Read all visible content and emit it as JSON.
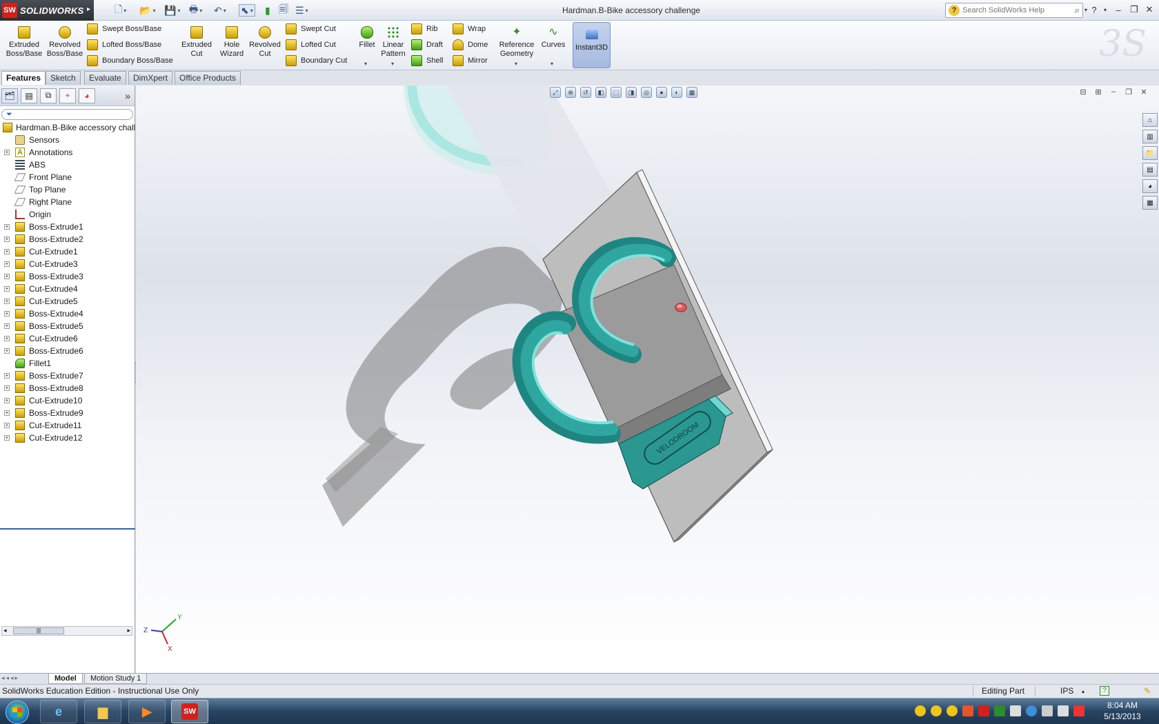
{
  "app": {
    "logo_badge": "SW",
    "logo_text": "SOLIDWORKS",
    "window_title": "Hardman.B-Bike accessory challenge"
  },
  "search": {
    "placeholder": "Search SolidWorks Help"
  },
  "toolbar": {
    "extruded_boss": [
      "Extruded",
      "Boss/Base"
    ],
    "revolved_boss": [
      "Revolved",
      "Boss/Base"
    ],
    "swept_boss": "Swept Boss/Base",
    "lofted_boss": "Lofted Boss/Base",
    "boundary_boss": "Boundary Boss/Base",
    "extruded_cut": [
      "Extruded",
      "Cut"
    ],
    "hole_wizard": [
      "Hole",
      "Wizard"
    ],
    "revolved_cut": [
      "Revolved",
      "Cut"
    ],
    "swept_cut": "Swept Cut",
    "lofted_cut": "Lofted Cut",
    "boundary_cut": "Boundary Cut",
    "fillet": "Fillet",
    "linear_pattern": [
      "Linear",
      "Pattern"
    ],
    "rib": "Rib",
    "draft": "Draft",
    "shell": "Shell",
    "wrap": "Wrap",
    "dome": "Dome",
    "mirror": "Mirror",
    "reference_geometry": [
      "Reference",
      "Geometry"
    ],
    "curves": "Curves",
    "instant3d": "Instant3D"
  },
  "tabs": [
    "Features",
    "Sketch",
    "Evaluate",
    "DimXpert",
    "Office Products"
  ],
  "active_tab": "Features",
  "feature_tree": {
    "root": "Hardman.B-Bike accessory challe",
    "items": [
      {
        "label": "Sensors",
        "expandable": false,
        "icon": "sensor-icon"
      },
      {
        "label": "Annotations",
        "expandable": true,
        "icon": "annotation-icon"
      },
      {
        "label": "ABS",
        "expandable": false,
        "icon": "material-icon"
      },
      {
        "label": "Front Plane",
        "expandable": false,
        "icon": "plane-icon"
      },
      {
        "label": "Top Plane",
        "expandable": false,
        "icon": "plane-icon"
      },
      {
        "label": "Right Plane",
        "expandable": false,
        "icon": "plane-icon"
      },
      {
        "label": "Origin",
        "expandable": false,
        "icon": "origin-icon"
      },
      {
        "label": "Boss-Extrude1",
        "expandable": true,
        "icon": "feature-icon"
      },
      {
        "label": "Boss-Extrude2",
        "expandable": true,
        "icon": "feature-icon"
      },
      {
        "label": "Cut-Extrude1",
        "expandable": true,
        "icon": "feature-icon"
      },
      {
        "label": "Cut-Extrude3",
        "expandable": true,
        "icon": "feature-icon"
      },
      {
        "label": "Boss-Extrude3",
        "expandable": true,
        "icon": "feature-icon"
      },
      {
        "label": "Cut-Extrude4",
        "expandable": true,
        "icon": "feature-icon"
      },
      {
        "label": "Cut-Extrude5",
        "expandable": true,
        "icon": "feature-icon"
      },
      {
        "label": "Boss-Extrude4",
        "expandable": true,
        "icon": "feature-icon"
      },
      {
        "label": "Boss-Extrude5",
        "expandable": true,
        "icon": "feature-icon"
      },
      {
        "label": "Cut-Extrude6",
        "expandable": true,
        "icon": "feature-icon"
      },
      {
        "label": "Boss-Extrude6",
        "expandable": true,
        "icon": "feature-icon"
      },
      {
        "label": "Fillet1",
        "expandable": false,
        "icon": "fillet-icon"
      },
      {
        "label": "Boss-Extrude7",
        "expandable": true,
        "icon": "feature-icon"
      },
      {
        "label": "Boss-Extrude8",
        "expandable": true,
        "icon": "feature-icon"
      },
      {
        "label": "Cut-Extrude10",
        "expandable": true,
        "icon": "feature-icon"
      },
      {
        "label": "Boss-Extrude9",
        "expandable": true,
        "icon": "feature-icon"
      },
      {
        "label": "Cut-Extrude11",
        "expandable": true,
        "icon": "feature-icon"
      },
      {
        "label": "Cut-Extrude12",
        "expandable": true,
        "icon": "feature-icon"
      }
    ]
  },
  "model": {
    "engraved_text": "VELODROOM",
    "accent_color": "#2fa7a0",
    "plate_color": "#b9b9b9"
  },
  "triad": {
    "x": "X",
    "y": "Y",
    "z": "Z"
  },
  "bottom_tabs": [
    "Model",
    "Motion Study 1"
  ],
  "status": {
    "left": "SolidWorks Education Edition - Instructional Use Only",
    "mode": "Editing Part",
    "units": "IPS",
    "help": "?"
  },
  "clock": {
    "time": "8:04 AM",
    "date": "5/13/2013"
  }
}
